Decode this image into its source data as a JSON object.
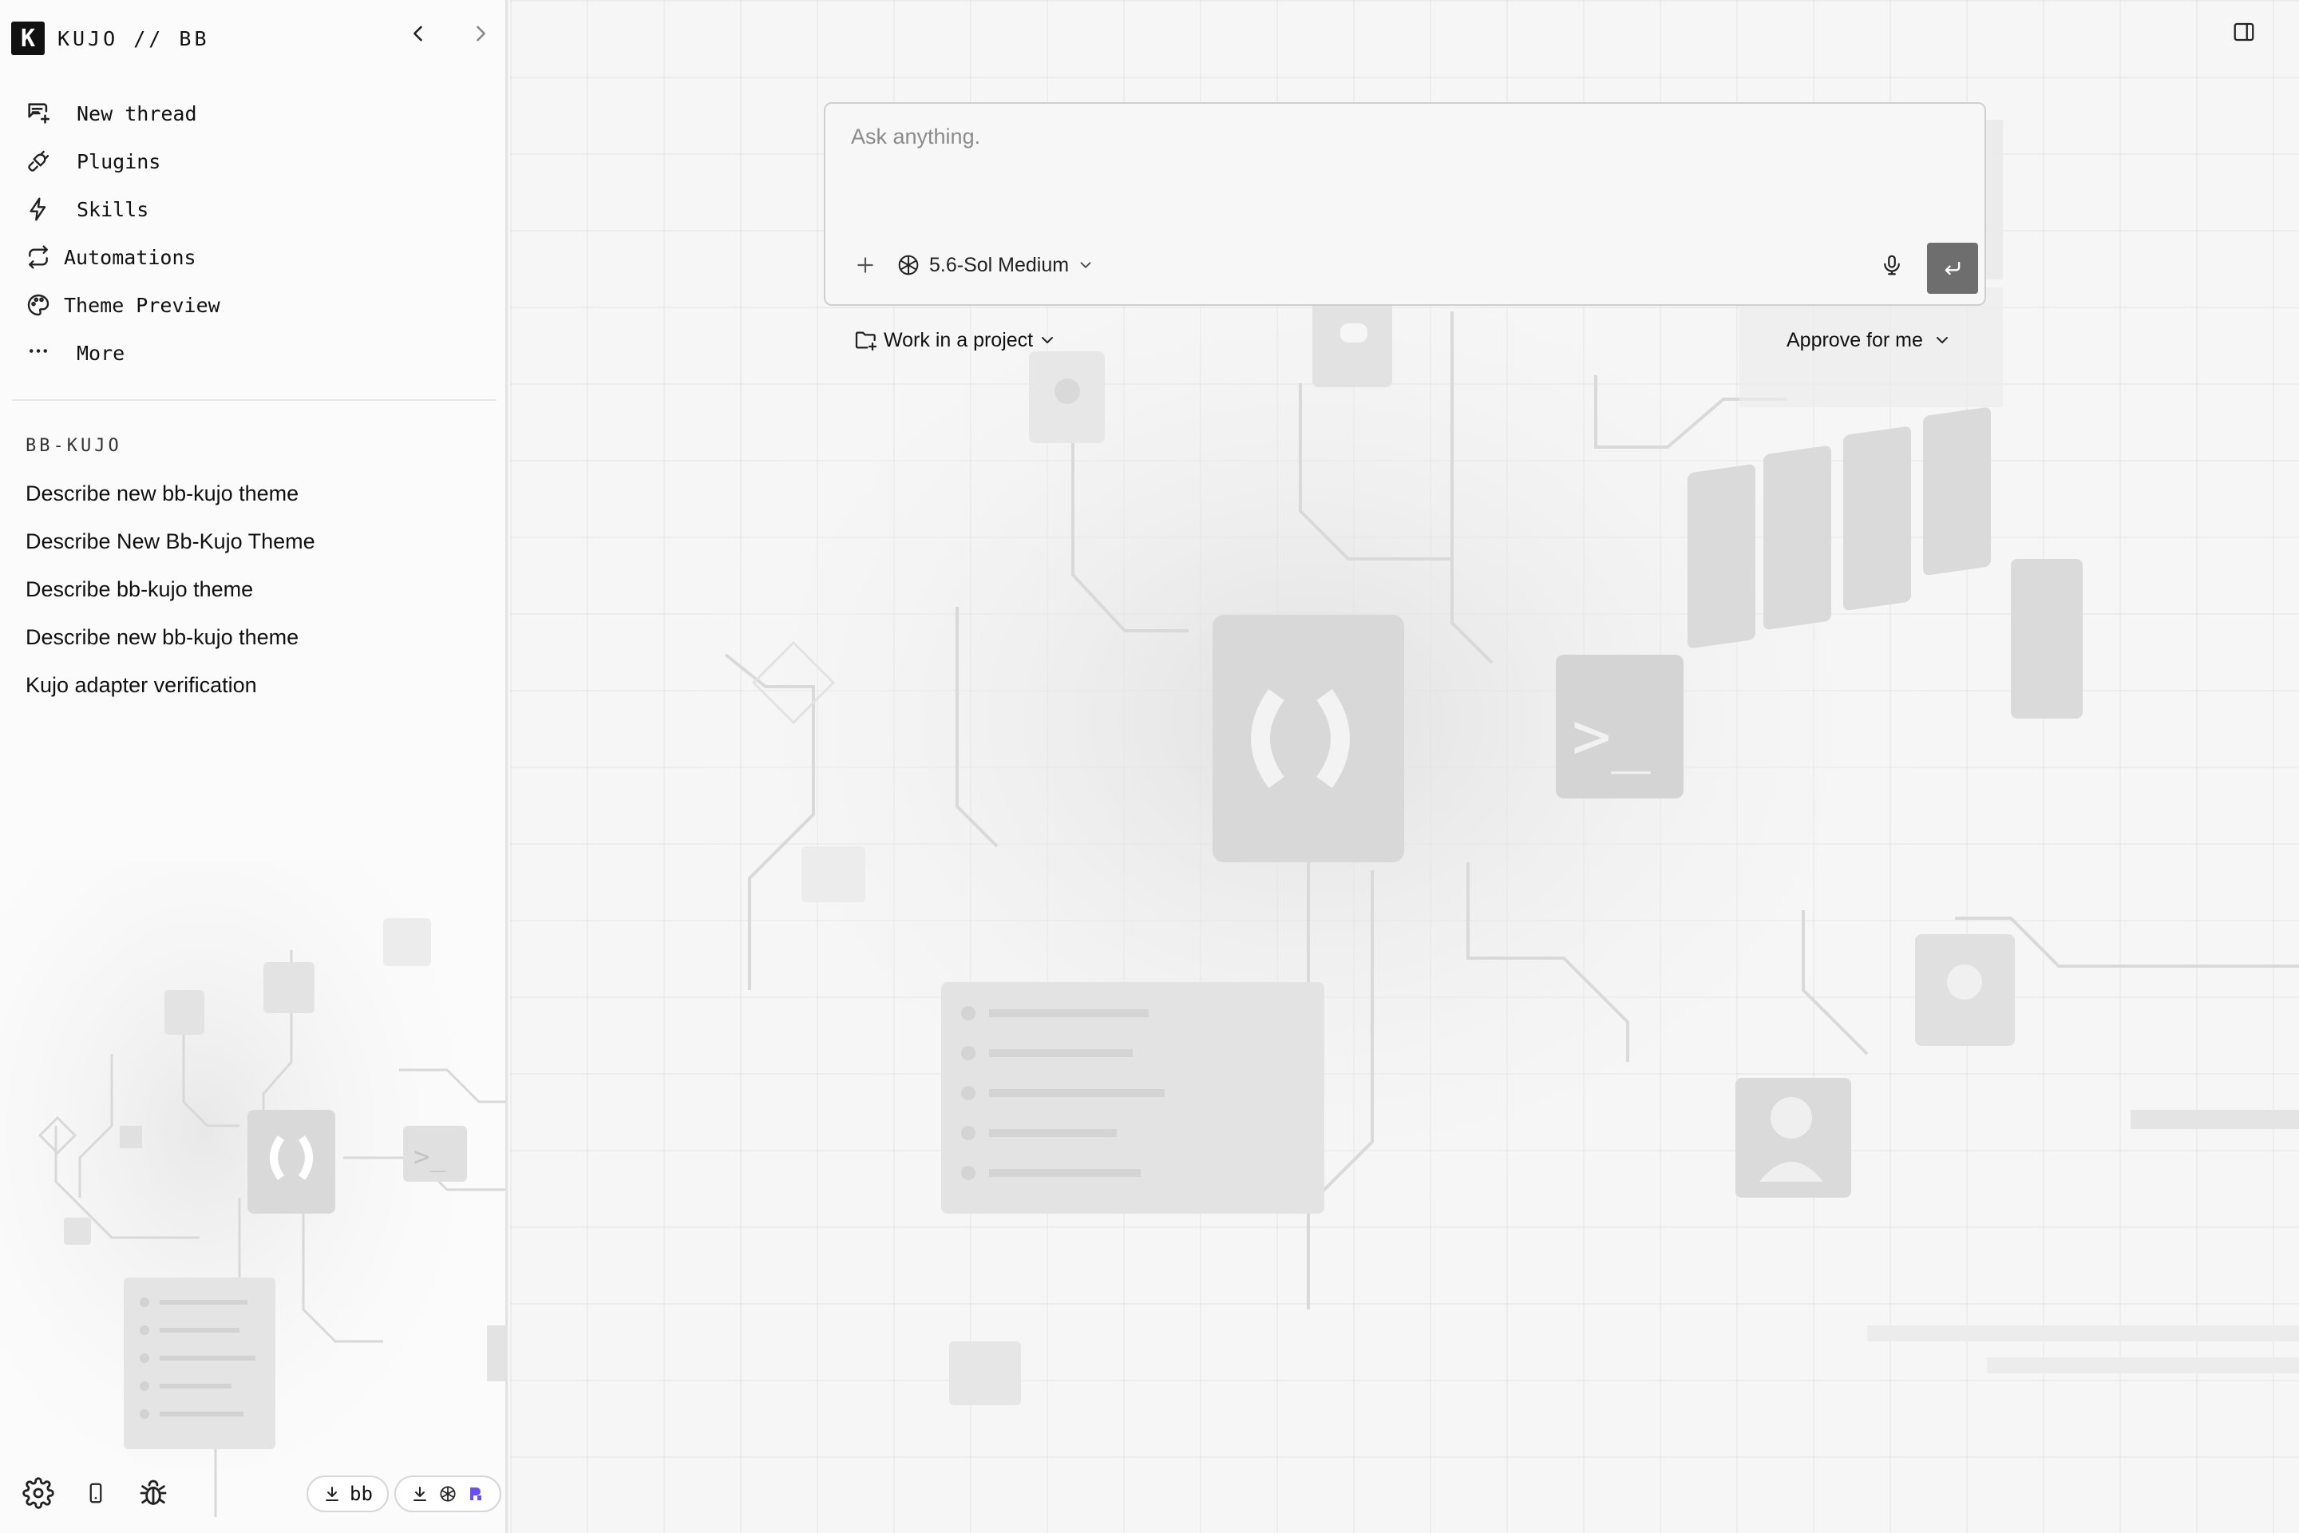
{
  "brand": {
    "logo_letter": "K",
    "title": "KUJO // BB"
  },
  "nav": {
    "back_icon": "chevron-left-icon",
    "forward_icon": "chevron-right-icon"
  },
  "menu": [
    {
      "label": "New thread",
      "icon": "new-thread-icon"
    },
    {
      "label": "Plugins",
      "icon": "plug-icon"
    },
    {
      "label": "Skills",
      "icon": "lightning-icon"
    },
    {
      "label": "Automations",
      "icon": "repeat-icon"
    },
    {
      "label": "Theme Preview",
      "icon": "palette-icon"
    },
    {
      "label": "More",
      "icon": "ellipsis-icon"
    }
  ],
  "section": {
    "title": "BB-KUJO"
  },
  "threads": [
    "Describe new bb-kujo theme",
    "Describe New Bb-Kujo Theme",
    "Describe bb-kujo theme",
    "Describe new bb-kujo theme",
    "Kujo adapter verification"
  ],
  "bottom": {
    "settings_icon": "gear-icon",
    "device_icon": "phone-icon",
    "debug_icon": "bug-icon",
    "pill_bb_label": "bb"
  },
  "composer": {
    "placeholder": "Ask anything.",
    "model_label": "5.6-Sol Medium",
    "project_label": "Work in a project",
    "approval_label": "Approve for me"
  },
  "colors": {
    "send_button": "#6e6e6e",
    "pill_accent": "#6b4ef5"
  }
}
